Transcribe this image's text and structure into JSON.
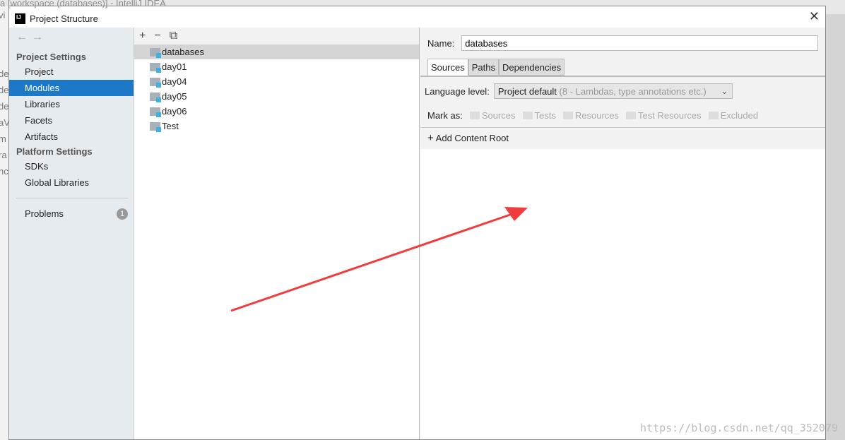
{
  "background": {
    "title": "a [workspace (databases)] - IntelliJ IDEA",
    "left_fragments": [
      "vi",
      "de",
      "de",
      "de",
      "aV",
      "m",
      "ra",
      "nc"
    ]
  },
  "dialog": {
    "title": "Project Structure",
    "close": "✕"
  },
  "sidebar": {
    "back": "←",
    "forward": "→",
    "project_settings": "Project Settings",
    "items": [
      "Project",
      "Modules",
      "Libraries",
      "Facets",
      "Artifacts"
    ],
    "platform_settings": "Platform Settings",
    "platform_items": [
      "SDKs",
      "Global Libraries"
    ],
    "problems": "Problems",
    "problems_count": "1",
    "selected": "Modules"
  },
  "tree": {
    "tools": [
      "+",
      "−",
      "⧉"
    ],
    "nodes": [
      "databases",
      "day01",
      "day04",
      "day05",
      "day06",
      "Test"
    ],
    "selected": "databases"
  },
  "module": {
    "name_label": "Name:",
    "name_value": "databases",
    "tabs": [
      "Sources",
      "Paths",
      "Dependencies"
    ],
    "active_tab": "Sources",
    "language_label": "Language level:",
    "language_value": "Project default",
    "language_hint": "(8 - Lambdas, type annotations etc.)",
    "mark_as": "Mark as:",
    "marks": [
      "Sources",
      "Tests",
      "Resources",
      "Test Resources",
      "Excluded"
    ],
    "add_content_root": "Add Content Root"
  },
  "annotation": {
    "arrow_color": "#f03c3c"
  },
  "watermark": "https://blog.csdn.net/qq_352079"
}
